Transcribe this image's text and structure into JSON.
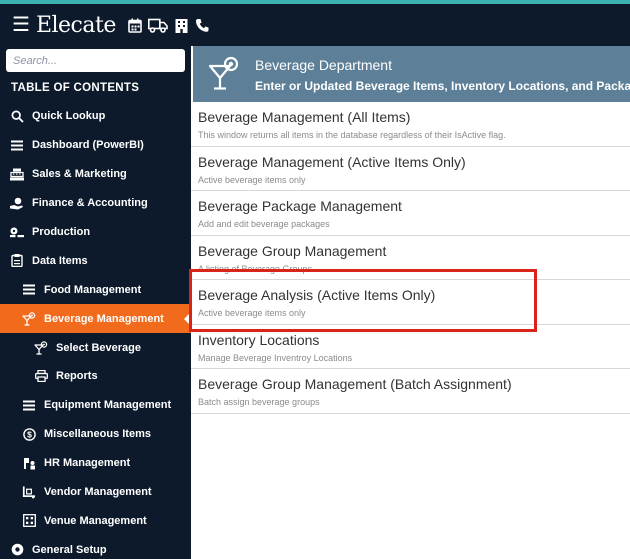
{
  "brand": {
    "name": "Elecate",
    "icons": [
      "calendar-icon",
      "truck-icon",
      "building-icon",
      "phone-icon"
    ]
  },
  "search": {
    "placeholder": "Search..."
  },
  "toc_title": "TABLE OF CONTENTS",
  "nav": [
    {
      "label": "Quick Lookup",
      "icon": "search-icon",
      "level": 0
    },
    {
      "label": "Dashboard (PowerBI)",
      "icon": "list-icon",
      "level": 0
    },
    {
      "label": "Sales & Marketing",
      "icon": "cash-register-icon",
      "level": 0
    },
    {
      "label": "Finance & Accounting",
      "icon": "money-hand-icon",
      "level": 0
    },
    {
      "label": "Production",
      "icon": "production-icon",
      "level": 0
    },
    {
      "label": "Data Items",
      "icon": "clipboard-icon",
      "level": 0
    },
    {
      "label": "Food Management",
      "icon": "list-icon",
      "level": 1
    },
    {
      "label": "Beverage Management",
      "icon": "cocktail-icon",
      "level": 1,
      "active": true
    },
    {
      "label": "Select Beverage",
      "icon": "cocktail-icon",
      "level": 2
    },
    {
      "label": "Reports",
      "icon": "printer-icon",
      "level": 2
    },
    {
      "label": "Equipment Management",
      "icon": "list-icon",
      "level": 1
    },
    {
      "label": "Miscellaneous Items",
      "icon": "dollar-circle-icon",
      "level": 1
    },
    {
      "label": "HR Management",
      "icon": "hr-icon",
      "level": 1
    },
    {
      "label": "Vendor Management",
      "icon": "truck-loading-icon",
      "level": 1
    },
    {
      "label": "Venue Management",
      "icon": "venue-icon",
      "level": 1
    },
    {
      "label": "General Setup",
      "icon": "settings-circle-icon",
      "level": 0
    }
  ],
  "department": {
    "title": "Beverage Department",
    "subtitle": "Enter or Updated Beverage Items, Inventory Locations, and Packa",
    "icon": "cocktail-icon"
  },
  "items": [
    {
      "title": "Beverage Management (All Items)",
      "desc": "This window returns all items in the database regardless of their IsActive flag."
    },
    {
      "title": "Beverage Management (Active Items Only)",
      "desc": "Active beverage items only"
    },
    {
      "title": "Beverage Package Management",
      "desc": "Add and edit beverage packages"
    },
    {
      "title": "Beverage Group Management",
      "desc": "A listing of Beverage Groups"
    },
    {
      "title": "Beverage Analysis (Active Items Only)",
      "desc": "Active beverage items only",
      "highlighted": true
    },
    {
      "title": "Inventory Locations",
      "desc": "Manage Beverage Inventroy Locations"
    },
    {
      "title": "Beverage Group Management (Batch Assignment)",
      "desc": "Batch assign beverage groups"
    }
  ],
  "colors": {
    "topbar": "#0d1a2b",
    "accent": "#f26a1b",
    "header": "#5d8098",
    "highlight": "#d9241b"
  }
}
